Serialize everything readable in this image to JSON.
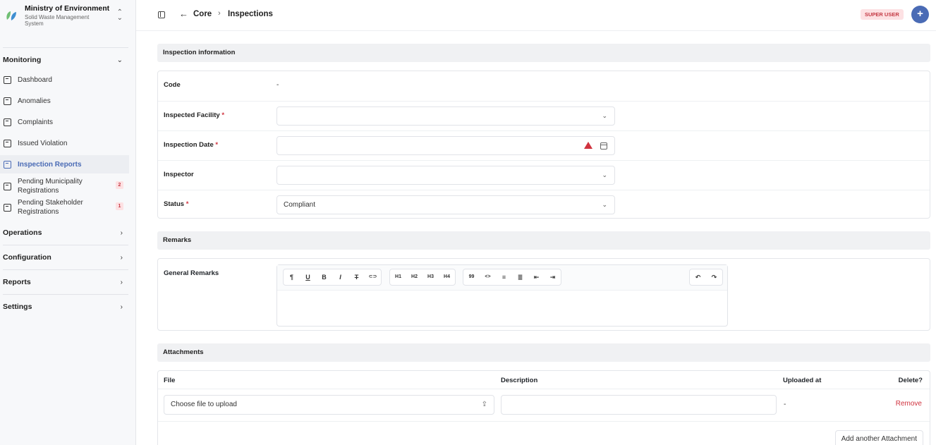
{
  "org": {
    "name": "Ministry of Environment",
    "subtitle": "Solid Waste Management System",
    "switch_icon": "chevron-up-down-icon"
  },
  "sidebar": {
    "monitoring": {
      "label": "Monitoring",
      "items": [
        {
          "label": "Dashboard"
        },
        {
          "label": "Anomalies"
        },
        {
          "label": "Complaints"
        },
        {
          "label": "Issued Violation"
        },
        {
          "label": "Inspection Reports",
          "active": true
        },
        {
          "label": "Pending Municipality Registrations",
          "badge": "2"
        },
        {
          "label": "Pending Stakeholder Registrations",
          "badge": "1"
        }
      ]
    },
    "groups": [
      {
        "label": "Operations"
      },
      {
        "label": "Configuration"
      },
      {
        "label": "Reports"
      },
      {
        "label": "Settings"
      }
    ]
  },
  "topbar": {
    "crumb_1": "Core",
    "crumb_2": "Inspections",
    "role_badge": "SUPER USER",
    "plus": "+"
  },
  "inspection": {
    "section_title": "Inspection information",
    "code_label": "Code",
    "code_value": "-",
    "facility_label": "Inspected Facility",
    "facility_value": "",
    "date_label": "Inspection Date",
    "date_value": "",
    "inspector_label": "Inspector",
    "inspector_value": "",
    "status_label": "Status",
    "status_value": "Compliant",
    "required_mark": "*"
  },
  "remarks": {
    "section_title": "Remarks",
    "general_label": "General Remarks",
    "toolbar": {
      "format": [
        "¶",
        "U",
        "B",
        "I",
        "T",
        "⊂⊃"
      ],
      "headings": [
        "H1",
        "H2",
        "H3",
        "H4"
      ],
      "blocks": [
        "99",
        "<>",
        "≡",
        "≣",
        "⇤",
        "⇥"
      ],
      "history": [
        "↶",
        "↷"
      ]
    }
  },
  "attachments": {
    "section_title": "Attachments",
    "headers": {
      "file": "File",
      "description": "Description",
      "uploaded": "Uploaded at",
      "delete": "Delete?"
    },
    "row": {
      "file_placeholder": "Choose file to upload",
      "uploaded": "-",
      "remove": "Remove"
    },
    "add_label": "Add another Attachment"
  },
  "colors": {
    "accent": "#4a6bb5",
    "danger": "#d0333f",
    "badge_bg": "#fde1e3"
  }
}
